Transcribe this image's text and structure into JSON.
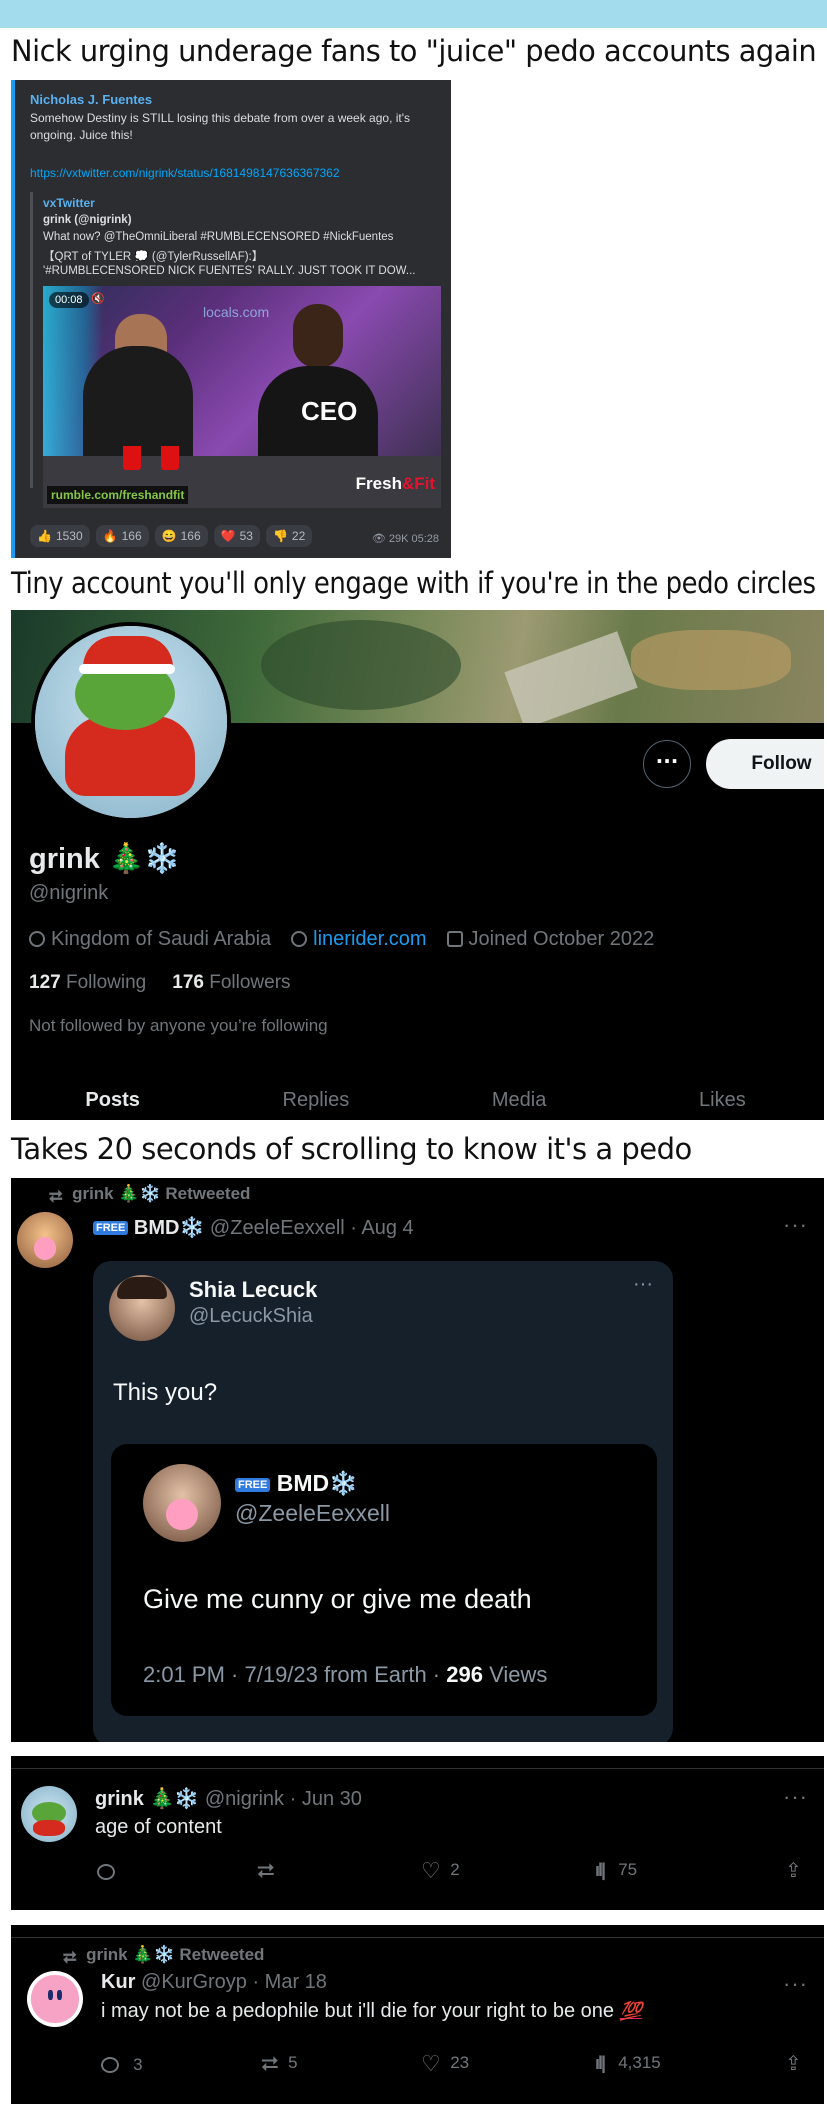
{
  "captions": {
    "c1": "Nick urging underage fans to \"juice\" pedo accounts again",
    "c2": "Tiny account you'll only engage with if you're in the pedo circles",
    "c3": "Takes 20 seconds of scrolling to know it's a pedo"
  },
  "embed": {
    "author": "Nicholas J. Fuentes",
    "text": "Somehow Destiny is STILL losing this debate from over a week ago, it's ongoing. Juice this!",
    "link": "https://vxtwitter.com/nigrink/status/1681498147636367362",
    "quote_author": "vxTwitter",
    "quote_lines": [
      "grink (@nigrink)",
      "What now? @TheOmniLiberal #RUMBLECENSORED #NickFuentes",
      "【QRT of TYLER 💭 (@TylerRussellAF):】",
      "'#RUMBLECENSORED NICK FUENTES' RALLY. JUST TOOK IT DOW..."
    ],
    "video_time": "00:08",
    "video_site": "rumble.com/freshandfit",
    "video_brand_a": "Fresh",
    "video_brand_b": "&Fit",
    "video_ceo": "CEO",
    "video_logo": "locals.com",
    "reactions": [
      {
        "emoji": "👍",
        "count": "1530"
      },
      {
        "emoji": "🔥",
        "count": "166"
      },
      {
        "emoji": "😄",
        "count": "166"
      },
      {
        "emoji": "❤️",
        "count": "53"
      },
      {
        "emoji": "👎",
        "count": "22"
      }
    ],
    "views": "👁 29K  05:28"
  },
  "profile": {
    "name": "grink 🎄❄️",
    "handle": "@nigrink",
    "location": "Kingdom of Saudi Arabia",
    "website": "linerider.com",
    "joined": "Joined October 2022",
    "following_count": "127",
    "following_label": "Following",
    "followers_count": "176",
    "followers_label": "Followers",
    "not_followed": "Not followed by anyone you’re following",
    "follow_label": "Follow",
    "more_label": "···",
    "tabs": [
      "Posts",
      "Replies",
      "Media",
      "Likes"
    ]
  },
  "tweet1": {
    "retweet_line": "grink 🎄❄️ Retweeted",
    "free": "FREE",
    "author": "BMD❄️",
    "handle_date": "@ZeeleEexxell · Aug 4",
    "dots": "···",
    "quote": {
      "name": "Shia Lecuck",
      "handle": "@LecuckShia",
      "dots": "···",
      "text": "This you?",
      "inner": {
        "free": "FREE",
        "name": "BMD❄️",
        "handle": "@ZeeleEexxell",
        "text": "Give me cunny or give me death",
        "meta_prefix": "2:01 PM · 7/19/23 from Earth · ",
        "views_count": "296",
        "views_label": " Views"
      }
    }
  },
  "tweet2": {
    "name": "grink 🎄❄️",
    "handle_date": "@nigrink · Jun 30",
    "text": "age of content",
    "dots": "···",
    "likes": "2",
    "views": "75"
  },
  "tweet3": {
    "retweet_line": "grink 🎄❄️ Retweeted",
    "name": "Kur",
    "handle_date": "@KurGroyp · Mar 18",
    "text": "i may not be a pedophile but i'll die for your right to be one",
    "emoji": "💯",
    "dots": "···",
    "replies": "3",
    "retweets": "5",
    "likes": "23",
    "views": "4,315"
  },
  "colors": {
    "top_bar": "#a3dcec",
    "x_blue": "#1d9bf0",
    "discord_bg": "#2b2d31"
  }
}
